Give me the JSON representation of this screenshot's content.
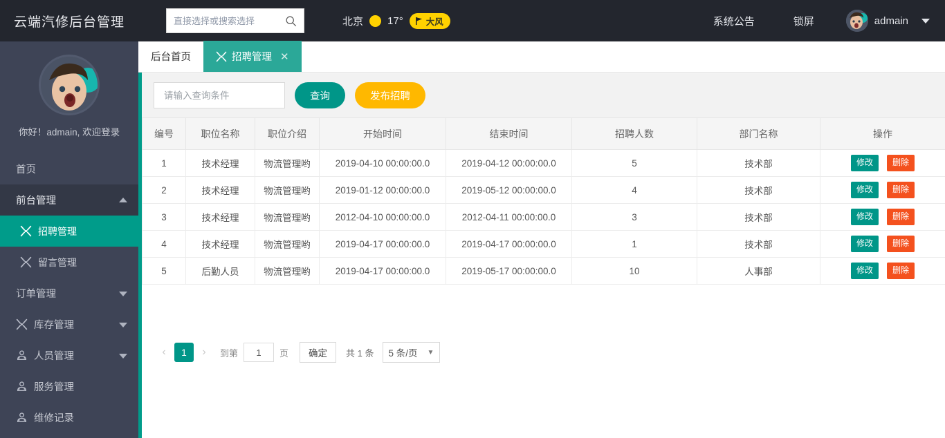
{
  "header": {
    "brand": "云端汽修后台管理",
    "search": {
      "placeholder": "直接选择或搜索选择",
      "value": "",
      "icon": "search-icon"
    },
    "weather": {
      "city": "北京",
      "sun_icon": "sun-icon",
      "temperature": "17°",
      "flag_icon": "flag-icon",
      "wind": "大风"
    },
    "links": [
      {
        "label": "系统公告"
      },
      {
        "label": "锁屏"
      }
    ],
    "user": {
      "name": "admain",
      "avatar": "user-avatar",
      "caret": "chevron-down-icon"
    },
    "colors": {
      "bar": "#23262E",
      "badge": "#FFD200"
    }
  },
  "sidebar": {
    "welcome": "你好！admain, 欢迎登录",
    "items": [
      {
        "label": "首页",
        "icon": null,
        "chevron": null,
        "state": "normal"
      },
      {
        "label": "前台管理",
        "icon": null,
        "chevron": "up",
        "state": "parent-open"
      },
      {
        "label": "招聘管理",
        "icon": "tools-icon",
        "chevron": null,
        "state": "active"
      },
      {
        "label": "留言管理",
        "icon": "tools-icon",
        "chevron": null,
        "state": "sub"
      },
      {
        "label": "订单管理",
        "icon": null,
        "chevron": "down",
        "state": "normal"
      },
      {
        "label": "库存管理",
        "icon": "tools-icon",
        "chevron": "down",
        "state": "normal"
      },
      {
        "label": "人员管理",
        "icon": "people-icon",
        "chevron": "down",
        "state": "normal"
      },
      {
        "label": "服务管理",
        "icon": "people-icon",
        "chevron": null,
        "state": "normal"
      },
      {
        "label": "维修记录",
        "icon": "people-icon",
        "chevron": null,
        "state": "normal"
      }
    ],
    "colors": {
      "bg": "#3E4456",
      "active": "#009C8A",
      "parent_open": "#333846"
    }
  },
  "tabs": [
    {
      "label": "后台首页",
      "icon": null,
      "active": false,
      "closable": false
    },
    {
      "label": "招聘管理",
      "icon": "tools-icon",
      "active": true,
      "closable": true,
      "close_glyph": "✕"
    }
  ],
  "toolbar": {
    "query_placeholder": "请输入查询条件",
    "query_value": "",
    "query_label": "查询",
    "publish_label": "发布招聘",
    "colors": {
      "query": "#009688",
      "publish": "#FFB800"
    }
  },
  "table": {
    "columns": [
      "编号",
      "职位名称",
      "职位介绍",
      "开始时间",
      "结束时间",
      "招聘人数",
      "部门名称",
      "操作"
    ],
    "rows": [
      {
        "id": "1",
        "title": "技术经理",
        "intro": "物流管理哟",
        "start": "2019-04-10 00:00:00.0",
        "end": "2019-04-12 00:00:00.0",
        "count": "5",
        "dept": "技术部"
      },
      {
        "id": "2",
        "title": "技术经理",
        "intro": "物流管理哟",
        "start": "2019-01-12 00:00:00.0",
        "end": "2019-05-12 00:00:00.0",
        "count": "4",
        "dept": "技术部"
      },
      {
        "id": "3",
        "title": "技术经理",
        "intro": "物流管理哟",
        "start": "2012-04-10 00:00:00.0",
        "end": "2012-04-11 00:00:00.0",
        "count": "3",
        "dept": "技术部"
      },
      {
        "id": "4",
        "title": "技术经理",
        "intro": "物流管理哟",
        "start": "2019-04-17 00:00:00.0",
        "end": "2019-04-17 00:00:00.0",
        "count": "1",
        "dept": "技术部"
      },
      {
        "id": "5",
        "title": "后勤人员",
        "intro": "物流管理哟",
        "start": "2019-04-17 00:00:00.0",
        "end": "2019-05-17 00:00:00.0",
        "count": "10",
        "dept": "人事部"
      }
    ],
    "row_actions": {
      "edit_label": "修改",
      "delete_label": "删除",
      "edit_color": "#009688",
      "delete_color": "#F4511E"
    }
  },
  "pagination": {
    "prev_glyph": "‹",
    "next_glyph": "›",
    "current_page": "1",
    "goto_prefix": "到第",
    "goto_value": "1",
    "goto_suffix": "页",
    "confirm_label": "确定",
    "total_label": "共 1 条",
    "page_size": "5 条/页",
    "select_caret": "▼"
  }
}
